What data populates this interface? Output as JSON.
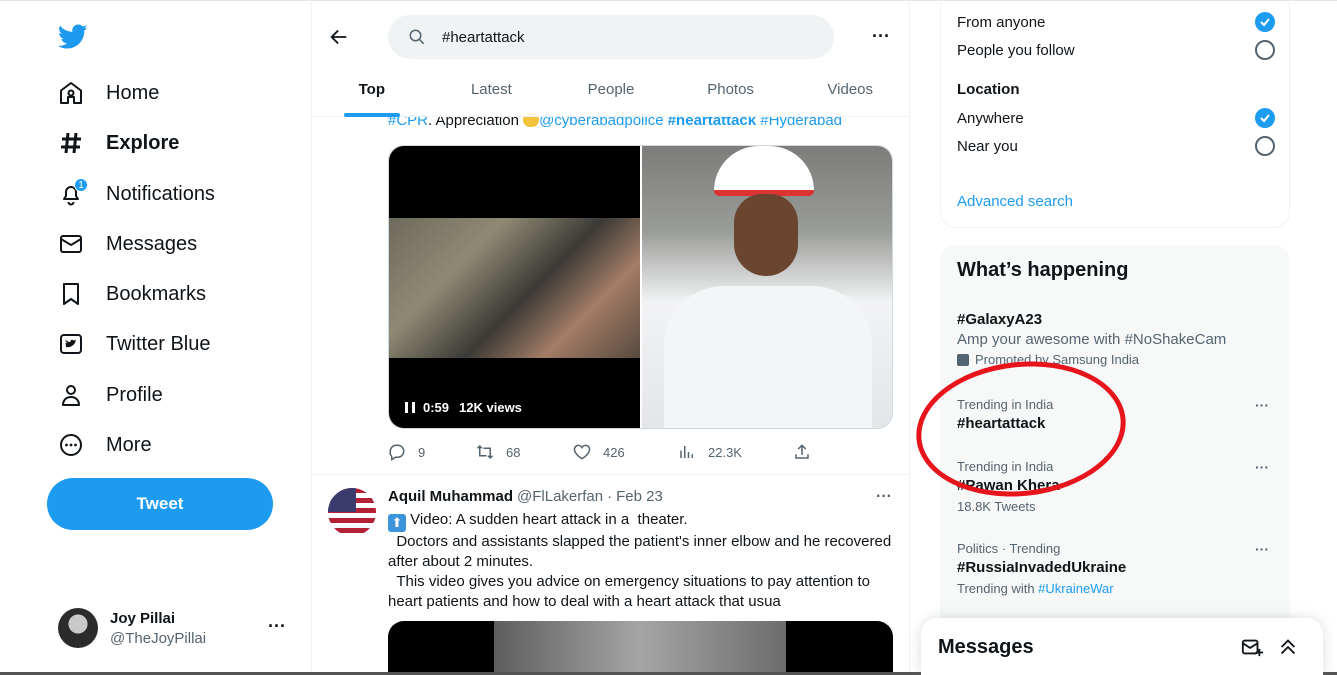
{
  "colors": {
    "accent": "#1d9bf0",
    "text": "#0f1419",
    "muted": "#536471",
    "annotation": "#e8141b"
  },
  "nav": {
    "logo": "twitter-bird-icon",
    "items": [
      {
        "label": "Home",
        "icon": "home-icon"
      },
      {
        "label": "Explore",
        "icon": "hashtag-icon"
      },
      {
        "label": "Notifications",
        "icon": "bell-icon",
        "badge": "1"
      },
      {
        "label": "Messages",
        "icon": "envelope-icon"
      },
      {
        "label": "Bookmarks",
        "icon": "bookmark-icon"
      },
      {
        "label": "Twitter Blue",
        "icon": "twitter-blue-icon"
      },
      {
        "label": "Profile",
        "icon": "person-icon"
      },
      {
        "label": "More",
        "icon": "more-circle-icon"
      }
    ],
    "tweet_button": "Tweet",
    "account": {
      "name": "Joy Pillai",
      "handle": "@TheJoyPillai",
      "more": "···"
    }
  },
  "search": {
    "query": "#heartattack",
    "more": "···",
    "tabs": [
      "Top",
      "Latest",
      "People",
      "Photos",
      "Videos"
    ],
    "active_tab": "Top"
  },
  "tweet1": {
    "line_tag1": "#CPR",
    "line_text": ". Appreciation ",
    "mention": "@cyberabadpolice",
    "highlight": "#heartattack",
    "tag2": "#Hyderabad",
    "video_time": "0:59",
    "video_views": "12K views",
    "replies": "9",
    "retweets": "68",
    "likes": "426",
    "views": "22.3K"
  },
  "tweet2": {
    "name": "Aquil Muhammad",
    "handle": "@FlLakerfan",
    "date": "Feb 23",
    "more": "···",
    "line1": " Video: A sudden heart attack in a  theater.",
    "rest": "  Doctors and assistants slapped the patient's inner elbow and he recovered after about 2 minutes.\n  This video gives you advice on emergency situations to pay attention to heart patients and how to deal with a heart attack that usua"
  },
  "filters": {
    "from_anyone": "From anyone",
    "people_you_follow": "People you follow",
    "location_heading": "Location",
    "anywhere": "Anywhere",
    "near_you": "Near you",
    "advanced": "Advanced search"
  },
  "happening": {
    "title": "What’s happening",
    "promo_tag": "#GalaxyA23",
    "promo_text": "Amp your awesome with #NoShakeCam",
    "promo_by": "Promoted by Samsung India",
    "trends": [
      {
        "context": "Trending in India",
        "tag": "#heartattack",
        "count": ""
      },
      {
        "context": "Trending in India",
        "tag": "#Pawan Khera",
        "count": "18.8K Tweets"
      },
      {
        "context": "Politics · Trending",
        "tag": "#RussiaInvadedUkraine",
        "with_label": "Trending with ",
        "with_tag": "#UkraineWar"
      }
    ],
    "more": "···"
  },
  "dock": {
    "title": "Messages"
  }
}
